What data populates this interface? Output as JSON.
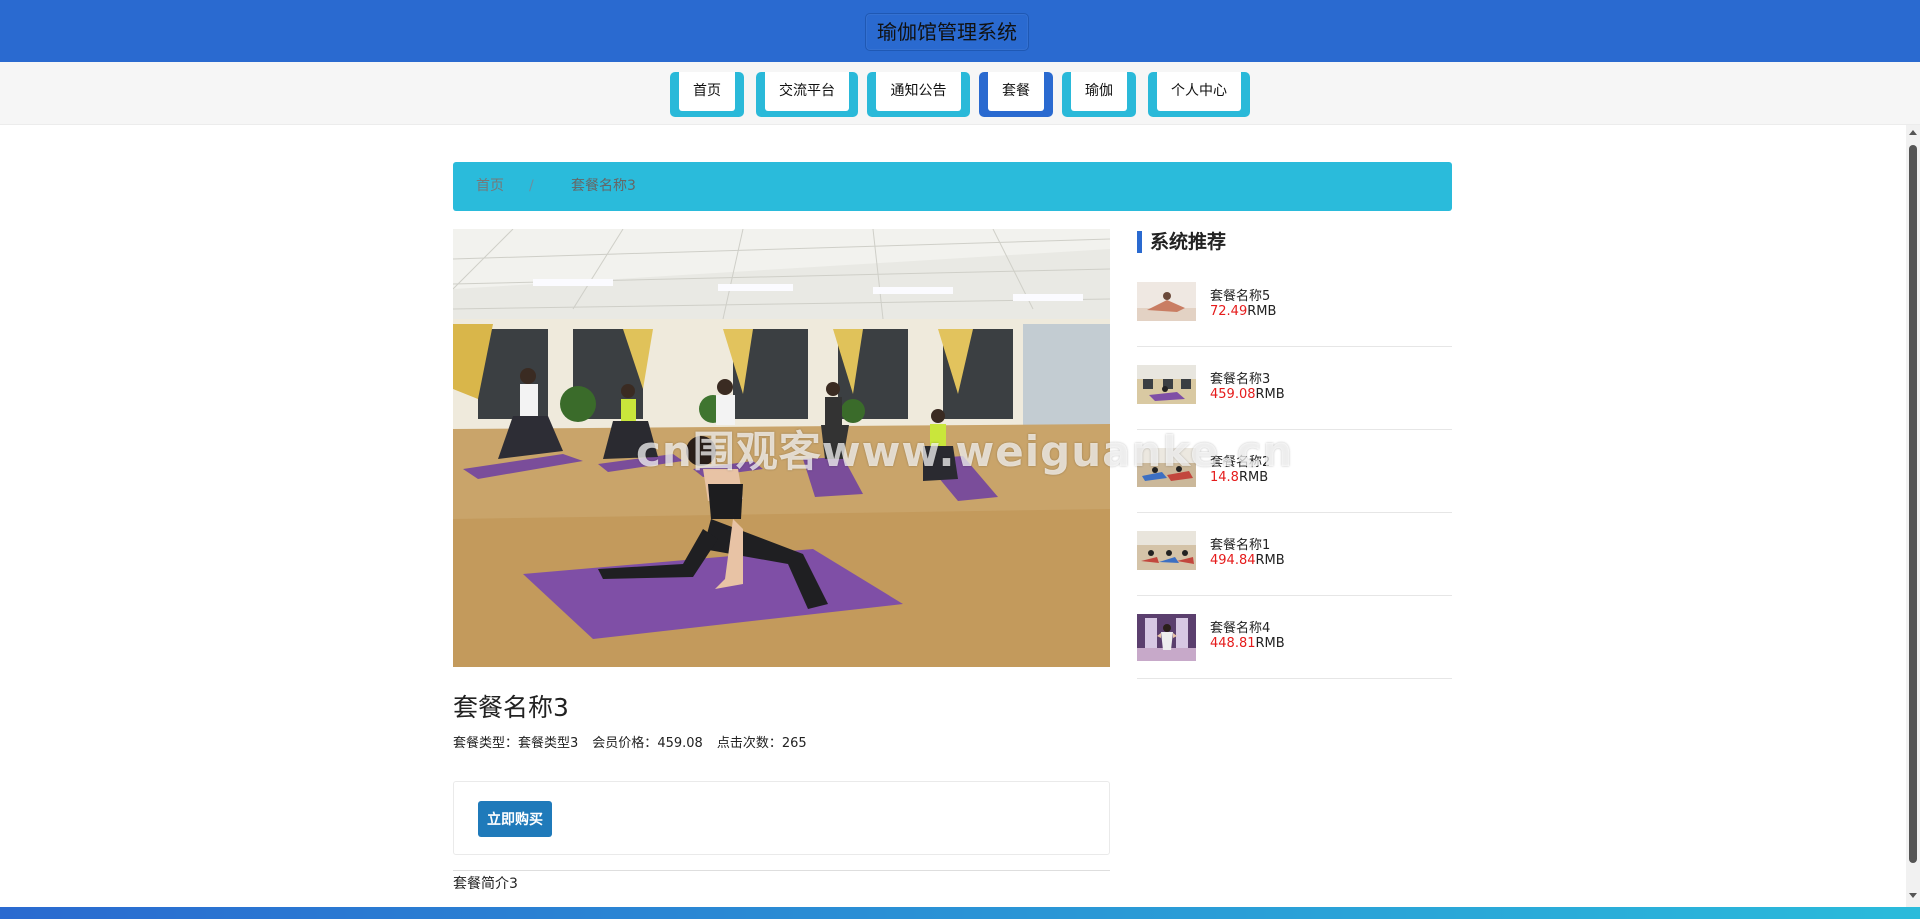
{
  "header": {
    "title": "瑜伽馆管理系统"
  },
  "nav": {
    "items": [
      {
        "label": "首页"
      },
      {
        "label": "交流平台"
      },
      {
        "label": "通知公告"
      },
      {
        "label": "套餐"
      },
      {
        "label": "瑜伽"
      },
      {
        "label": "个人中心"
      }
    ],
    "active": "套餐"
  },
  "breadcrumb": {
    "home": "首页",
    "separator": "/",
    "current": "套餐名称3"
  },
  "product": {
    "title": "套餐名称3",
    "type_label": "套餐类型：",
    "type_value": "套餐类型3",
    "price_label": "会员价格：",
    "price_value": "459.08",
    "clicks_label": "点击次数：",
    "clicks_value": "265",
    "buy_label": "立即购买",
    "description": "套餐简介3"
  },
  "recommend": {
    "title": "系统推荐",
    "items": [
      {
        "name": "套餐名称5",
        "price": "72.49",
        "unit": "RMB"
      },
      {
        "name": "套餐名称3",
        "price": "459.08",
        "unit": "RMB"
      },
      {
        "name": "套餐名称2",
        "price": "14.8",
        "unit": "RMB"
      },
      {
        "name": "套餐名称1",
        "price": "494.84",
        "unit": "RMB"
      },
      {
        "name": "套餐名称4",
        "price": "448.81",
        "unit": "RMB"
      }
    ]
  },
  "watermark": "cn围观客www.weiguanke.cn",
  "colors": {
    "header": "#2a6ad0",
    "nav_tab": "#2ab9d9",
    "breadcrumb": "#2abbdb",
    "price": "#e51b1b",
    "buy_button": "#1f7aba"
  }
}
